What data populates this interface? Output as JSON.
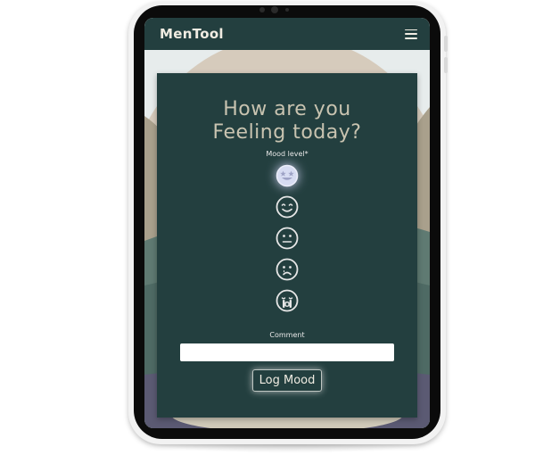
{
  "nav": {
    "brand": "MenTool",
    "menu_icon": "hamburger-menu-icon"
  },
  "mood_form": {
    "title_line1": "How are you",
    "title_line2": "Feeling today?",
    "mood_label": "Mood level*",
    "mood_options": [
      {
        "icon": "grin-stars-emoji-icon",
        "selected": true
      },
      {
        "icon": "smile-emoji-icon",
        "selected": false
      },
      {
        "icon": "neutral-emoji-icon",
        "selected": false
      },
      {
        "icon": "sad-tear-emoji-icon",
        "selected": false
      },
      {
        "icon": "sad-cry-emoji-icon",
        "selected": false
      }
    ],
    "comment_label": "Comment",
    "comment_value": "",
    "submit_label": "Log Mood"
  },
  "colors": {
    "primary": "#233f3f",
    "title_text": "#c8c3b0",
    "light_text": "#f0ece2"
  }
}
